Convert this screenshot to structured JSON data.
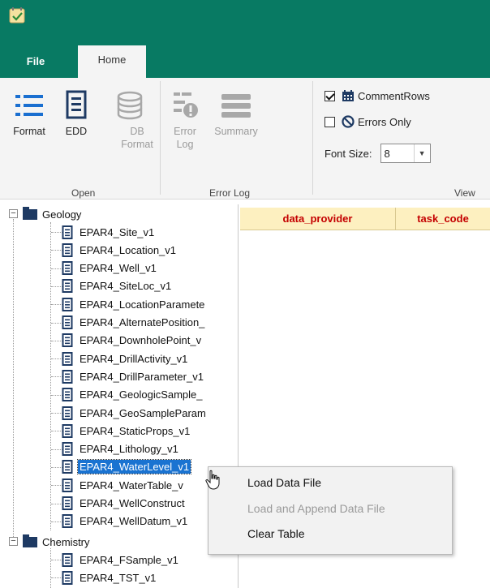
{
  "ribbon_tabs": [
    {
      "label": "File"
    },
    {
      "label": "Home"
    }
  ],
  "ribbon": {
    "open_group": {
      "label": "Open",
      "buttons": [
        {
          "label": "Format",
          "icon": "list-format-icon"
        },
        {
          "label": "EDD",
          "icon": "document-icon"
        },
        {
          "label": "DB Format",
          "icon": "database-icon",
          "disabled": true
        }
      ]
    },
    "error_log_group": {
      "label": "Error Log",
      "buttons": [
        {
          "label": "Error Log",
          "icon": "error-log-icon",
          "disabled": true
        },
        {
          "label": "Summary",
          "icon": "summary-icon",
          "disabled": true
        }
      ]
    },
    "view_group": {
      "label": "View",
      "comment_rows": {
        "label": "CommentRows",
        "checked": true,
        "icon": "calendar-grid-icon"
      },
      "errors_only": {
        "label": "Errors Only",
        "checked": false,
        "icon": "no-entry-icon"
      },
      "font_size": {
        "label": "Font Size:",
        "value": "8"
      }
    }
  },
  "tree": {
    "geology": {
      "label": "Geology",
      "items": [
        "EPAR4_Site_v1",
        "EPAR4_Location_v1",
        "EPAR4_Well_v1",
        "EPAR4_SiteLoc_v1",
        "EPAR4_LocationParamete",
        "EPAR4_AlternatePosition_",
        "EPAR4_DownholePoint_v",
        "EPAR4_DrillActivity_v1",
        "EPAR4_DrillParameter_v1",
        "EPAR4_GeologicSample_",
        "EPAR4_GeoSampleParam",
        "EPAR4_StaticProps_v1",
        "EPAR4_Lithology_v1",
        "EPAR4_WaterLevel_v1",
        "EPAR4_WaterTable_v",
        "EPAR4_WellConstruct",
        "EPAR4_WellDatum_v1"
      ],
      "selected": "EPAR4_WaterLevel_v1"
    },
    "chemistry": {
      "label": "Chemistry",
      "items": [
        "EPAR4_FSample_v1",
        "EPAR4_TST_v1"
      ]
    }
  },
  "grid": {
    "columns": [
      "data_provider",
      "task_code"
    ]
  },
  "context_menu": {
    "items": [
      {
        "label": "Load Data File",
        "enabled": true
      },
      {
        "label": "Load and Append Data File",
        "enabled": false
      },
      {
        "label": "Clear Table",
        "enabled": true
      }
    ]
  },
  "colors": {
    "title_bar": "#087a63",
    "selection": "#1a73d1",
    "column_header_bg": "#fdf0c0",
    "column_header_text": "#c40000"
  }
}
